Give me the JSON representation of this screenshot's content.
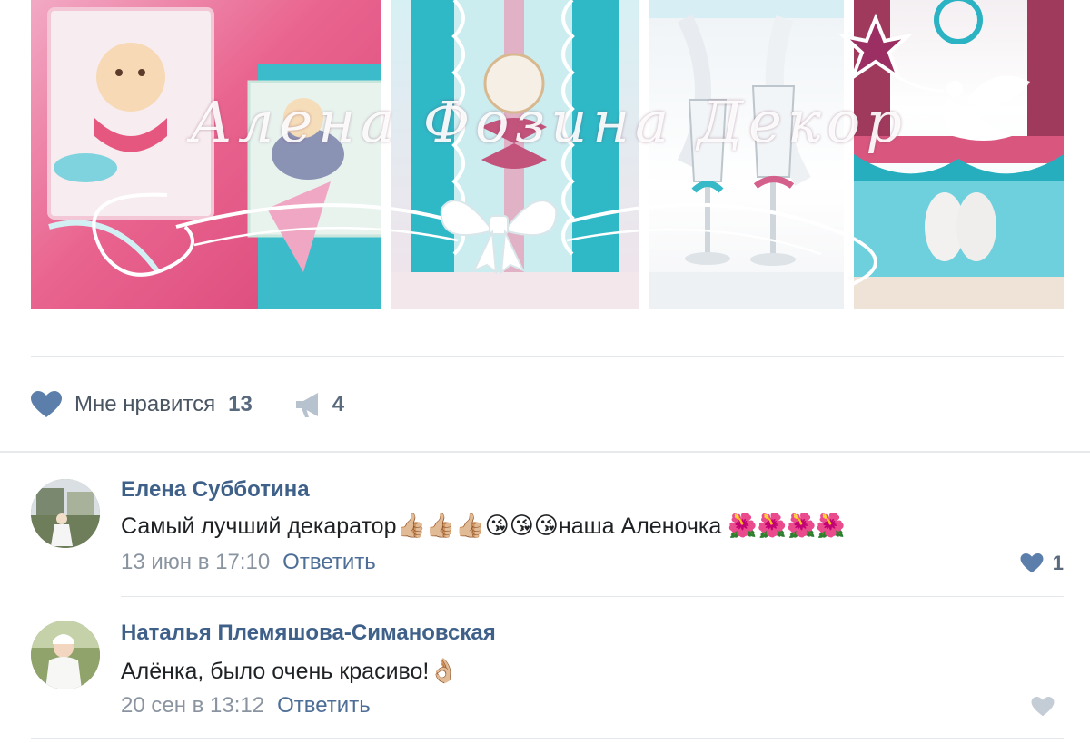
{
  "post": {
    "watermark": "Алена Фозина Декор",
    "actions": {
      "like_label": "Мне нравится",
      "like_count": "13",
      "share_count": "4",
      "like_icon": "heart-icon",
      "share_icon": "megaphone-icon"
    }
  },
  "comments": [
    {
      "author": "Елена Субботина",
      "text": "Самый лучший декаратор",
      "emojis_a": "👍🏼👍🏼👍🏼😘😘😘",
      "text2": "наша Аленочка",
      "emojis_b": "🌺🌺🌺🌺",
      "date": "13 июн в 17:10",
      "reply": "Ответить",
      "likes": "1"
    },
    {
      "author": "Наталья Племяшова-Симановская",
      "text": "Алёнка, было очень красиво!",
      "emojis_a": "👌🏼",
      "date": "20 сен в 13:12",
      "reply": "Ответить",
      "likes": ""
    }
  ],
  "colors": {
    "link": "#3f6189",
    "icon": "#5b7faa",
    "icon_muted": "#b7c2cf"
  }
}
